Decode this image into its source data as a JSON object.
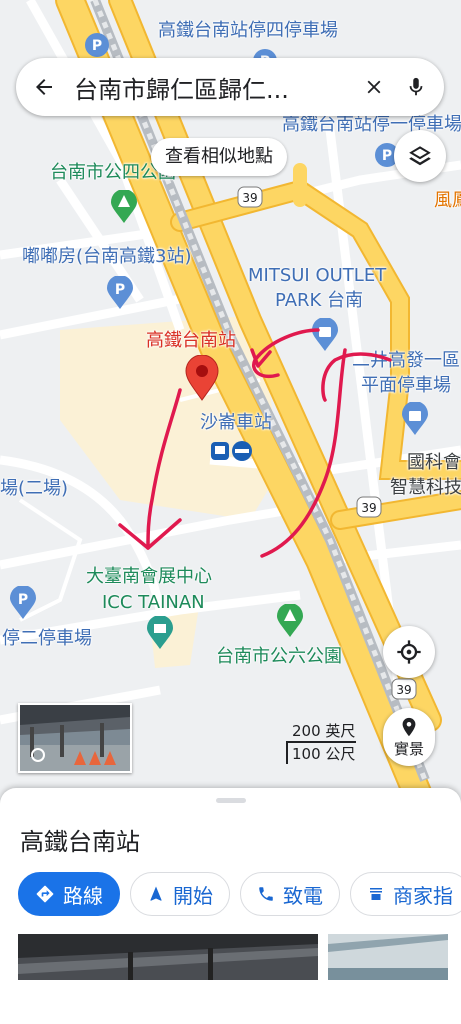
{
  "search": {
    "query": "台南市歸仁區歸仁..."
  },
  "similar_chip": "查看相似地點",
  "map_labels": {
    "parking4": "高鐵台南站停四停車場",
    "parking1": "高鐵台南站停一停車場",
    "park4": "台南市公四公園",
    "dudu": "嘟嘟房(台南高鐵3站)",
    "mitsui1": "MITSUI OUTLET",
    "mitsui2": "PARK 台南",
    "hsr": "高鐵台南站",
    "shalun": "沙崙車站",
    "mitsui_lot1": "二井高發一區",
    "mitsui_lot2": "平面停車場",
    "guoke1": "國科會",
    "guoke2": "智慧科技",
    "icc1": "大臺南會展中心",
    "icc2": "ICC TAINAN",
    "park6": "台南市公六公園",
    "parking2": "停二停車場",
    "lot_left": "場(二場)",
    "edge_left": "",
    "feng": "風鳳",
    "route39": "39"
  },
  "scale": {
    "imperial": "200 英尺",
    "metric": "100 公尺"
  },
  "streetview_btn": "實景",
  "sheet": {
    "title": "高鐵台南站",
    "actions": [
      "路線",
      "開始",
      "致電",
      "商家指"
    ]
  },
  "colors": {
    "road_major": "#fdd663",
    "road_edge": "#f2b731",
    "accent": "#1a73e8",
    "pin": "#ea4335",
    "annotation": "#e0194e"
  }
}
